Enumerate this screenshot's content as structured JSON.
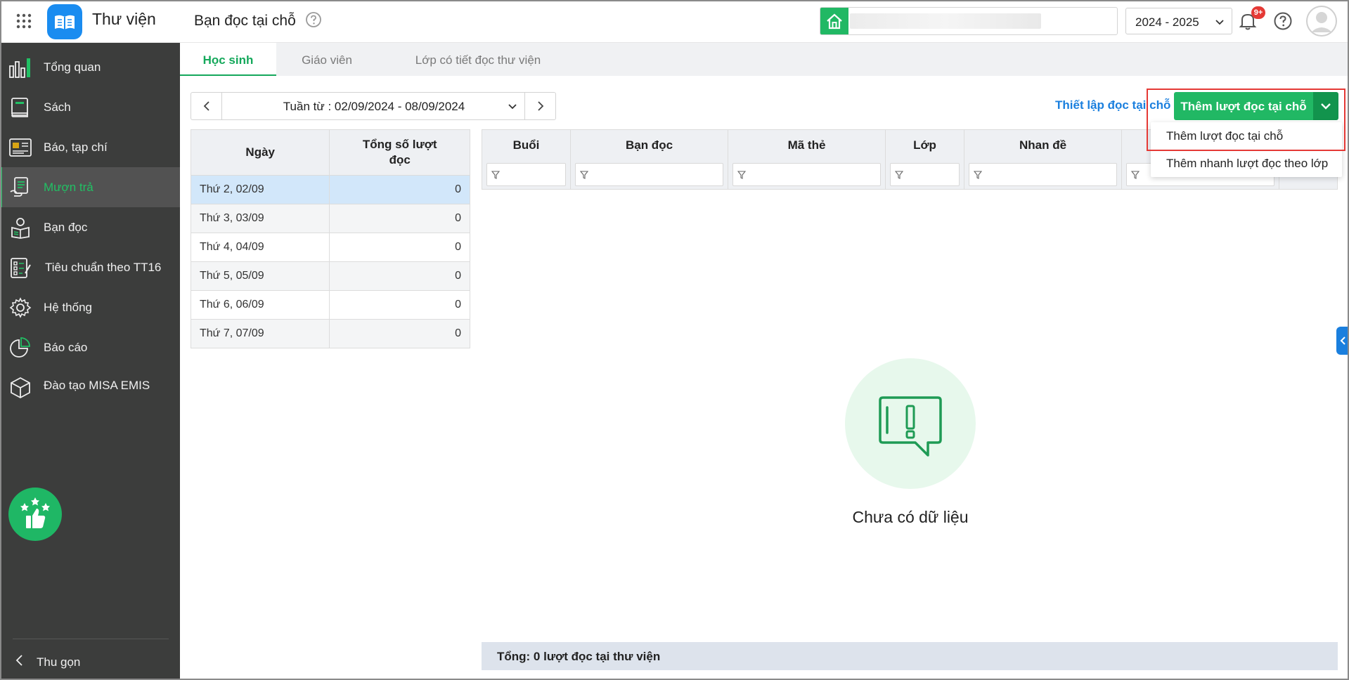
{
  "header": {
    "app_title": "Thư viện",
    "page_title": "Bạn đọc tại chỗ",
    "school_year": "2024 - 2025",
    "notification_badge": "9+"
  },
  "sidebar": {
    "items": [
      {
        "label": "Tổng quan",
        "icon": "overview-chart-icon"
      },
      {
        "label": "Sách",
        "icon": "book-icon"
      },
      {
        "label": "Báo, tạp chí",
        "icon": "newspaper-icon"
      },
      {
        "label": "Mượn trả",
        "icon": "borrow-return-icon",
        "active": true
      },
      {
        "label": "Bạn đọc",
        "icon": "reader-icon"
      },
      {
        "label": "Tiêu chuẩn theo TT16",
        "icon": "checklist-icon"
      },
      {
        "label": "Hệ thống",
        "icon": "gear-icon"
      },
      {
        "label": "Báo cáo",
        "icon": "pie-chart-icon"
      },
      {
        "label": "Đào tạo MISA EMIS",
        "icon": "cube-icon"
      }
    ],
    "collapse_label": "Thu gọn"
  },
  "tabs": [
    {
      "label": "Học sinh",
      "active": true
    },
    {
      "label": "Giáo viên"
    },
    {
      "label": "Lớp có tiết đọc thư viện"
    }
  ],
  "week": {
    "range": "Tuần từ : 02/09/2024 - 08/09/2024"
  },
  "actions": {
    "setup_link": "Thiết lập đọc tại chỗ",
    "add_button": "Thêm lượt đọc tại chỗ",
    "dropdown_items": [
      "Thêm lượt đọc tại chỗ",
      "Thêm nhanh lượt đọc theo lớp"
    ]
  },
  "day_table": {
    "headers": [
      "Ngày",
      "Tổng số lượt đọc"
    ],
    "rows": [
      {
        "day": "Thứ 2, 02/09",
        "count": "0"
      },
      {
        "day": "Thứ 3, 03/09",
        "count": "0"
      },
      {
        "day": "Thứ 4, 04/09",
        "count": "0"
      },
      {
        "day": "Thứ 5, 05/09",
        "count": "0"
      },
      {
        "day": "Thứ 6, 06/09",
        "count": "0"
      },
      {
        "day": "Thứ 7, 07/09",
        "count": "0"
      }
    ]
  },
  "grid": {
    "columns": [
      "Buổi",
      "Bạn đọc",
      "Mã thẻ",
      "Lớp",
      "Nhan đề",
      ""
    ]
  },
  "empty": {
    "message": "Chưa có dữ liệu"
  },
  "footer": {
    "summary": "Tổng: 0 lượt đọc tại thư viện"
  },
  "colors": {
    "primary_green": "#21b864",
    "sidebar_bg": "#3c3d3c",
    "link_blue": "#1a7fde",
    "highlight_red": "#e53935"
  }
}
